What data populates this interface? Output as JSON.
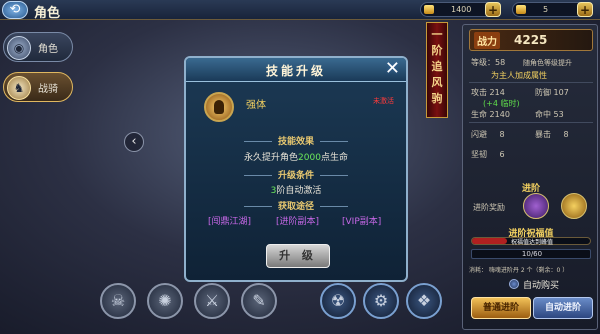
{
  "topbar": {
    "title": "角色",
    "gold": "1400",
    "ingot": "5",
    "plus_label": "+",
    "close_label": "✕",
    "back_label": "⟲"
  },
  "tabs": [
    {
      "label": "角色",
      "icon": "helmet-icon",
      "glyph": "◉"
    },
    {
      "label": "战骑",
      "icon": "mount-icon",
      "glyph": "♞"
    }
  ],
  "arrow_left": "‹",
  "banner": [
    "一",
    "阶",
    "追",
    "风",
    "驹"
  ],
  "modal": {
    "title": "技能升级",
    "close": "✕",
    "skill_name": "强体",
    "skill_status": "未激活",
    "effect_title": "技能效果",
    "effect_pre": "永久提升角色",
    "effect_num": "2000",
    "effect_post": "点生命",
    "cond_title": "升级条件",
    "cond_num": "3",
    "cond_post": "阶自动激活",
    "acq_title": "获取途径",
    "acq": [
      "[闯鼎江湖]",
      "[进阶副本]",
      "[VIP副本]"
    ],
    "upgrade": "升 级"
  },
  "right": {
    "power_label": "战力",
    "power_value": "4225",
    "level_label": "等级：",
    "level_value": "58",
    "level_note": "随角色等级提升",
    "bonus_note": "为主人加成属性",
    "attack_label": "攻击",
    "attack_value": "214",
    "defense_label": "防御",
    "defense_value": "107",
    "attack_bonus": "(+4 临时)",
    "hp_label": "生命",
    "hp_value": "2140",
    "hit_label": "命中",
    "hit_value": "53",
    "dodge_label": "闪避",
    "dodge_value": "8",
    "crit_label": "暴击",
    "crit_value": "8",
    "tough_label": "坚韧",
    "tough_value": "6",
    "advance_title": "进阶",
    "reward_label": "进阶奖励",
    "bless_title": "进阶祝福值",
    "bless_bar_text": "祝福值达到峰值",
    "bless_fraction": 0.3,
    "progress_text": "10/60",
    "cost_text": "消耗：  嗨魂进阶丹  2 个（剩余：0 ）",
    "auto_buy": "自动购买",
    "btn_left": "普通进阶",
    "btn_right": "自动进阶"
  },
  "skills": [
    {
      "name": "skill-slot-1",
      "glyph": "☠",
      "style": "grey"
    },
    {
      "name": "skill-slot-2",
      "glyph": "✺",
      "style": "grey"
    },
    {
      "name": "skill-slot-3",
      "glyph": "⚔",
      "style": "grey"
    },
    {
      "name": "skill-slot-4",
      "glyph": "✎",
      "style": "grey"
    },
    {
      "name": "skill-slot-5",
      "glyph": "☢",
      "style": "blue"
    },
    {
      "name": "skill-slot-6",
      "glyph": "⚙",
      "style": "blue"
    },
    {
      "name": "skill-slot-7",
      "glyph": "❖",
      "style": "blue"
    }
  ]
}
